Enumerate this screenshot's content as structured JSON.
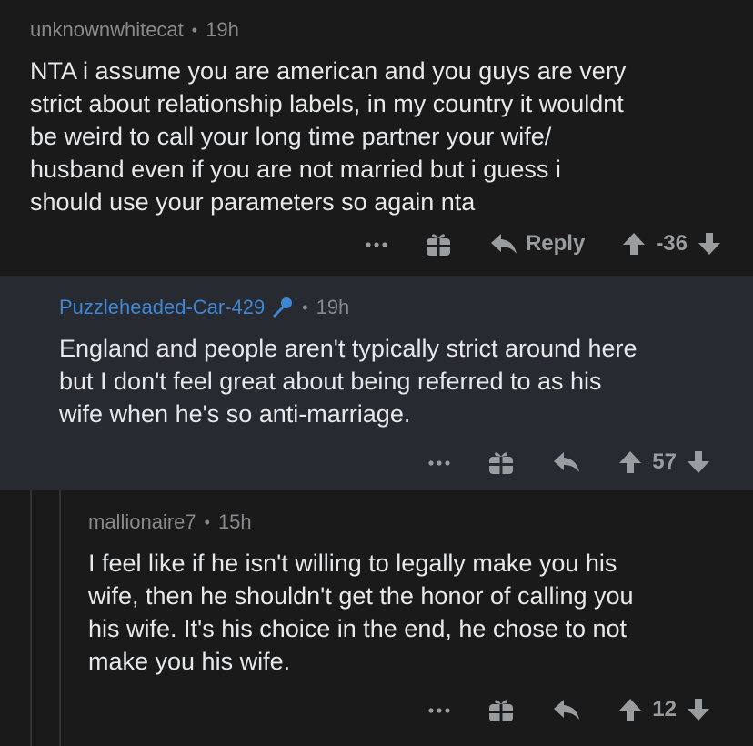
{
  "comments": [
    {
      "author": "unknownwhitecat",
      "time": "19h",
      "body": "NTA i assume you are american and you guys are very\nstrict about relationship labels, in my country it wouldnt\nbe weird to call your long time partner your wife/\nhusband even if you are not married but i guess i\nshould use your parameters so again nta",
      "reply_label": "Reply",
      "score": "-36"
    },
    {
      "author": "Puzzleheaded-Car-429",
      "time": "19h",
      "body": "England and people aren't typically strict around here\nbut I don't feel great about being referred to as his\nwife when he's so anti-marriage.",
      "score": "57"
    },
    {
      "author": "mallionaire7",
      "time": "15h",
      "body": "I feel like if he isn't willing to legally make you his\nwife, then he shouldn't get the honor of calling you\nhis wife. It's his choice in the end, he chose to not\nmake you his wife.",
      "score": "12"
    }
  ],
  "colors": {
    "background": "#1a1a1b",
    "highlight_background": "#272a30",
    "op_author": "#3f86d4",
    "meta_text": "#878a8c",
    "body_text": "#e6e8ea"
  },
  "icons": [
    "more-icon",
    "gift-icon",
    "reply-icon",
    "upvote-icon",
    "downvote-icon",
    "mod-mic-icon"
  ]
}
